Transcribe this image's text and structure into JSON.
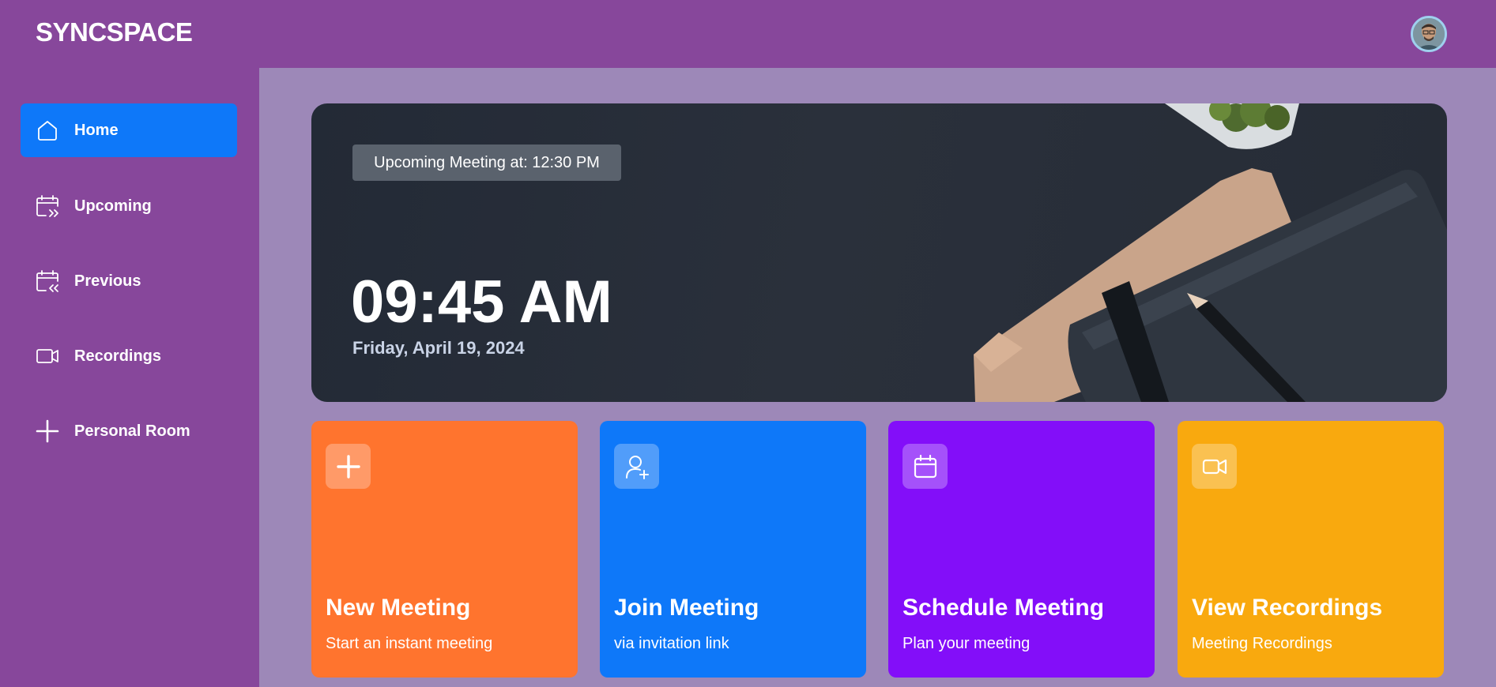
{
  "app": {
    "brand": "SYNCSPACE"
  },
  "user": {
    "avatar_icon": "user-avatar"
  },
  "sidebar": {
    "items": [
      {
        "label": "Home",
        "icon": "home-icon",
        "active": true
      },
      {
        "label": "Upcoming",
        "icon": "calendar-forward-icon",
        "active": false
      },
      {
        "label": "Previous",
        "icon": "calendar-back-icon",
        "active": false
      },
      {
        "label": "Recordings",
        "icon": "video-icon",
        "active": false
      },
      {
        "label": "Personal Room",
        "icon": "plus-icon",
        "active": false
      }
    ]
  },
  "hero": {
    "badge": "Upcoming Meeting at: 12:30 PM",
    "time": "09:45 AM",
    "date": "Friday, April 19, 2024"
  },
  "cards": [
    {
      "title": "New Meeting",
      "subtitle": "Start an instant meeting",
      "icon": "plus-icon",
      "color": "#ff742e"
    },
    {
      "title": "Join Meeting",
      "subtitle": "via invitation link",
      "icon": "user-add-icon",
      "color": "#0e78f9"
    },
    {
      "title": "Schedule Meeting",
      "subtitle": "Plan your meeting",
      "icon": "calendar-icon",
      "color": "#830ef9"
    },
    {
      "title": "View Recordings",
      "subtitle": "Meeting Recordings",
      "icon": "video-icon",
      "color": "#f9a90e"
    }
  ],
  "colors": {
    "topbar": "#87479b",
    "main_bg": "#9d88b8",
    "active_nav": "#0e78f9"
  }
}
